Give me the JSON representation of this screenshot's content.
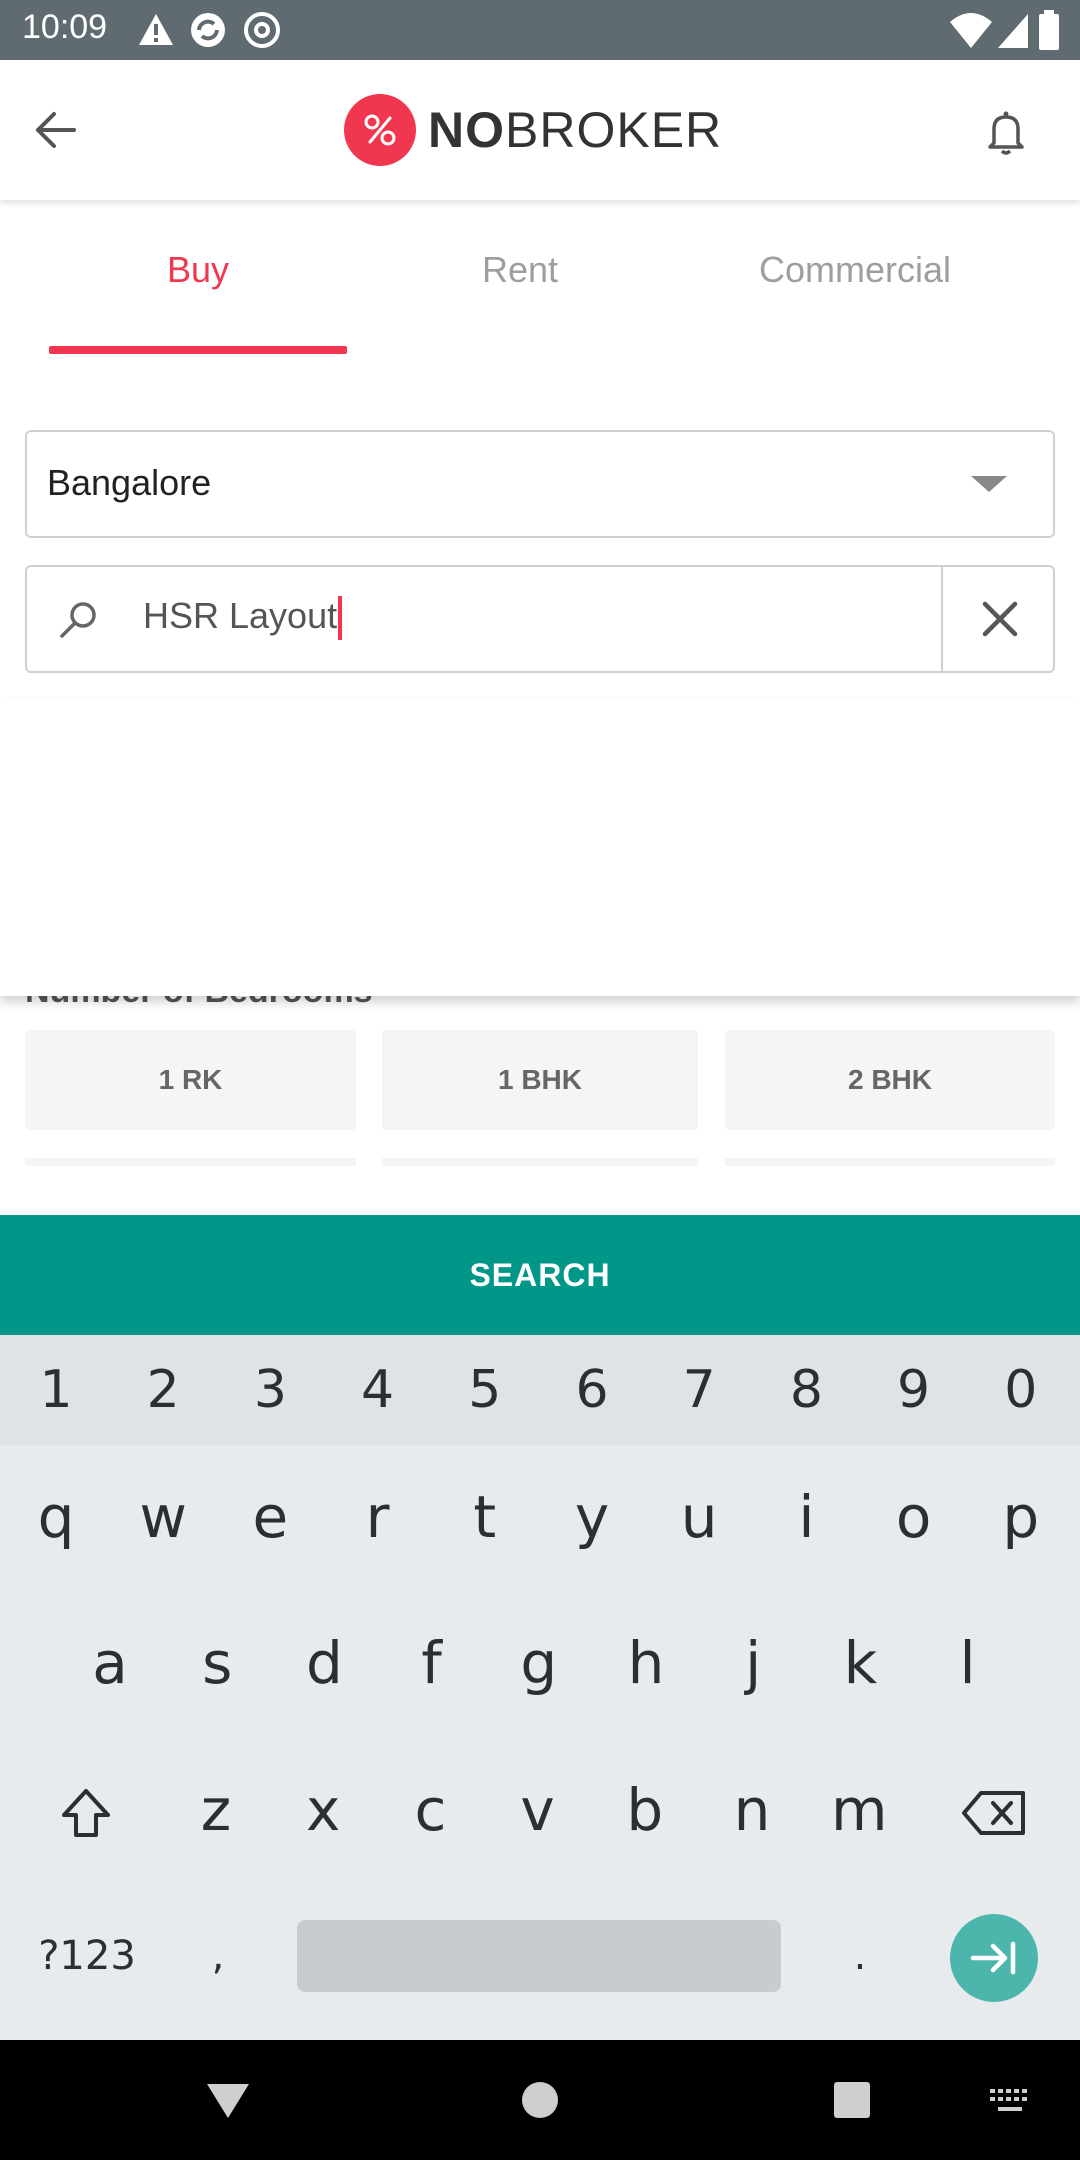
{
  "status_bar": {
    "time": "10:09",
    "left_icons": [
      "warning-icon",
      "sync-icon",
      "at-sign-icon"
    ],
    "right_icons": [
      "wifi-icon",
      "signal-icon",
      "battery-icon"
    ]
  },
  "header": {
    "logo_no": "NO",
    "logo_broker": "BROKER",
    "back_icon": "arrow-left-icon",
    "bell_icon": "bell-icon"
  },
  "tabs": [
    {
      "label": "Buy",
      "active": true
    },
    {
      "label": "Rent",
      "active": false
    },
    {
      "label": "Commercial",
      "active": false
    }
  ],
  "city": {
    "value": "Bangalore"
  },
  "search": {
    "value": "HSR Layout"
  },
  "bedrooms": {
    "label": "Number of Bedrooms",
    "options": [
      "1 RK",
      "1 BHK",
      "2 BHK"
    ]
  },
  "search_button": {
    "label": "SEARCH"
  },
  "keyboard": {
    "numbers": [
      "1",
      "2",
      "3",
      "4",
      "5",
      "6",
      "7",
      "8",
      "9",
      "0"
    ],
    "row1": [
      "q",
      "w",
      "e",
      "r",
      "t",
      "y",
      "u",
      "i",
      "o",
      "p"
    ],
    "row2": [
      "a",
      "s",
      "d",
      "f",
      "g",
      "h",
      "j",
      "k",
      "l"
    ],
    "row3": [
      "z",
      "x",
      "c",
      "v",
      "b",
      "n",
      "m"
    ],
    "symbols": "?123",
    "comma": ",",
    "period": "."
  },
  "colors": {
    "brand": "#f0374f",
    "search_button": "#009688",
    "status_bar": "#5f6b71"
  }
}
